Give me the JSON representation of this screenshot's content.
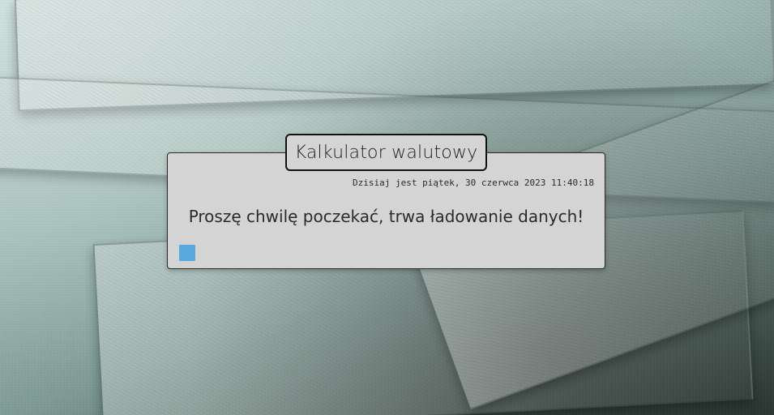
{
  "app": {
    "title": "Kalkulator walutowy"
  },
  "header": {
    "datetime": "Dzisiaj jest piątek, 30 czerwca 2023 11:40:18"
  },
  "main": {
    "loading_message": "Proszę chwilę poczekać, trwa ładowanie danych!"
  },
  "loader": {
    "icon": "loading-square-icon",
    "color": "#5ba8e0"
  },
  "colors": {
    "panel_bg": "#d4d4d4",
    "border": "#111111",
    "text": "#2a2a2a"
  }
}
